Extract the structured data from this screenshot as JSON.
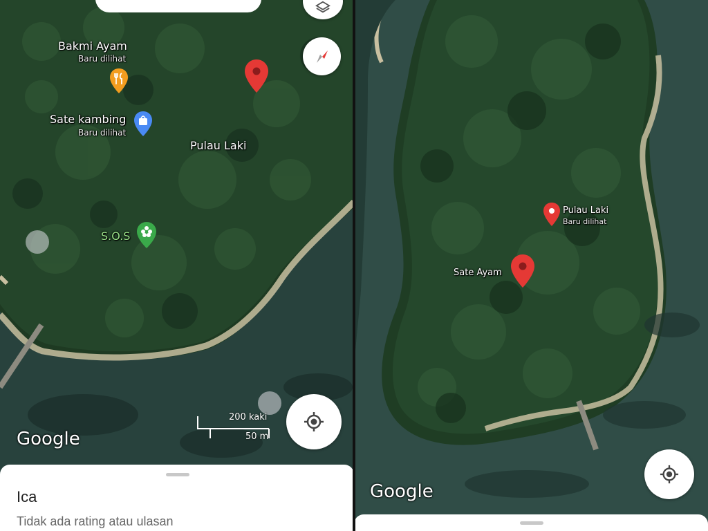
{
  "left_panel": {
    "places": {
      "bakmi_name": "Bakmi Ayam",
      "bakmi_sub": "Baru dilihat",
      "sate_kambing_name": "Sate kambing",
      "sate_kambing_sub": "Baru dilihat",
      "island": "Pulau Laki",
      "sos": "S.O.S"
    },
    "scale": {
      "feet": "200 kaki",
      "meters": "50 m"
    },
    "logo": "Google",
    "sheet": {
      "title": "Ica",
      "subtitle": "Tidak ada rating atau ulasan"
    }
  },
  "right_panel": {
    "places": {
      "island_name": "Pulau Laki",
      "island_sub": "Baru dilihat",
      "sate_ayam": "Sate Ayam"
    },
    "logo": "Google"
  },
  "colors": {
    "pin_red": "#e53935",
    "food_orange": "#f29d1f",
    "shop_blue": "#4a8af4",
    "sos_green": "#3aa94a"
  },
  "icons": [
    "layers-icon",
    "compass-icon",
    "my-location-icon",
    "map-pin-icon",
    "restaurant-icon",
    "shopping-bag-icon",
    "flower-icon"
  ]
}
